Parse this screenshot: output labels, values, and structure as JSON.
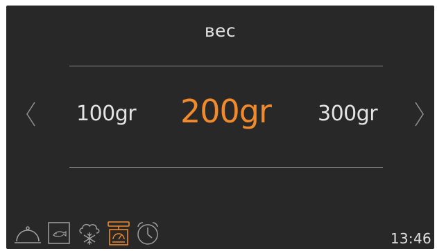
{
  "header": {
    "title": "вес"
  },
  "weight_picker": {
    "previous_option": "100gr",
    "selected_option": "200gr",
    "next_option": "300gr"
  },
  "bottom_bar": {
    "icons": [
      "dish-icon",
      "oven-icon",
      "defrost-icon",
      "scale-icon",
      "timer-icon"
    ],
    "active_icon": "scale-icon",
    "time": "13:46"
  },
  "colors": {
    "background": "#282828",
    "accent": "#f08a2c",
    "text": "#e4e4e4",
    "icon_inactive": "#a0a0a0"
  }
}
